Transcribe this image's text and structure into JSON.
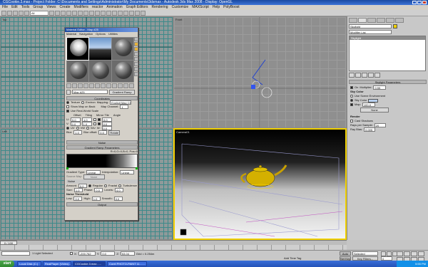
{
  "window": {
    "title": "CGCookie.3.max - Project Folder: C:\\Documents and Settings\\Administrator\\My Documents\\3dsmax - Autodesk 3ds Max 2008 - Display: OpenGL"
  },
  "menubar": [
    "File",
    "Edit",
    "Tools",
    "Group",
    "Views",
    "Create",
    "Modifiers",
    "reactor",
    "Animation",
    "Graph Editors",
    "Rendering",
    "Customize",
    "MAXScript",
    "Help",
    "PolyBoost"
  ],
  "toolbar": {
    "selection_filter": "All"
  },
  "viewports": {
    "top": {
      "label": "Top"
    },
    "front": {
      "label": "Front"
    },
    "left": {
      "label": "Left"
    },
    "perspective": {
      "label": "Camera01"
    }
  },
  "material_editor": {
    "title": "Material Editor - Map #25",
    "menu": [
      "Material",
      "Navigation",
      "Options",
      "Utilities"
    ],
    "map_name": "Map #25",
    "map_type": "Gradient Ramp",
    "coordinates": {
      "header": "Coordinates",
      "texture": "Texture",
      "environ": "Environ",
      "mapping_label": "Mapping:",
      "mapping": "Explicit Map Channel",
      "show_map_on_back": "Show Map on Back",
      "map_channel_label": "Map Channel:",
      "map_channel": "1",
      "use_real_world": "Use Real-World Scale",
      "offset": "Offset",
      "tiling": "Tiling",
      "mirror_tile": "Mirror Tile",
      "angle": "Angle",
      "u": "U:",
      "v": "V:",
      "w": "W:",
      "u_offset": "0.0",
      "v_offset": "0.0",
      "u_tiling": "1.0",
      "v_tiling": "1.0",
      "u_angle": "0.0",
      "v_angle": "0.0",
      "w_angle": "0.0",
      "uv": "UV",
      "vw": "VW",
      "wu": "WU",
      "blur_label": "Blur:",
      "blur": "1.0",
      "blur_offset_label": "Blur offset:",
      "blur_offset": "0.0",
      "rotate": "Rotate"
    },
    "noise_header": "Noise",
    "gradient": {
      "header": "Gradient Ramp Parameters",
      "pos_readout": "R=0,G=0,B=0, Pos=0",
      "type_label": "Gradient Type:",
      "type": "Linear",
      "interp_label": "Interpolation:",
      "interp": "Linear",
      "source_map": "Source Map",
      "none": "None"
    },
    "noise": {
      "header": "Noise",
      "amount_label": "Amount:",
      "amount": "0.0",
      "regular": "Regular",
      "fractal": "Fractal",
      "turbulence": "Turbulence",
      "size_label": "Size:",
      "size": "1.0",
      "phase_label": "Phase:",
      "phase": "0.0",
      "levels_label": "Levels:",
      "levels": "4.0"
    },
    "thresholds": {
      "header": "Noise Threshold",
      "low_label": "Low:",
      "low": "0.0",
      "high_label": "High:",
      "high": "1.0",
      "smooth_label": "Smooth:",
      "smooth": "0.0"
    },
    "output_header": "Output"
  },
  "command_panel": {
    "object_name": "Skylight",
    "modifier_list": "Modifier List",
    "stack_item": "Skylight",
    "rollout": "Skylight Parameters",
    "on_label": "On",
    "multiplier_label": "Multiplier:",
    "multiplier": "0.55",
    "sky_color_label": "Sky Color",
    "use_scene_env": "Use Scene Environment",
    "sky_color": "Sky Color",
    "map_label": "Map:",
    "map_value": "100.0",
    "none_btn": "None",
    "render_label": "Render",
    "cast_shadows": "Cast Shadows",
    "rays_label": "Rays per Sample:",
    "rays": "20",
    "ray_bias_label": "Ray Bias:",
    "ray_bias": "0.005",
    "accent": "#f0d000"
  },
  "timeline": {
    "frame": "0 / 100"
  },
  "status": {
    "selection": "1 Light Selected",
    "x_label": "X:",
    "x": "-200.762",
    "y_label": "Y:",
    "y": "0.0",
    "z_label": "Z:",
    "z": "53.04",
    "grid": "Grid = 0.254m",
    "auto_key": "Auto Key",
    "selected": "Selected",
    "set_key": "Set Key",
    "key_filters": "Key Filters...",
    "add_time_tag": "Add Time Tag",
    "frame": "0"
  },
  "taskbar": {
    "start": "start",
    "tasks": [
      "Local Disk (C:)",
      "RealPlayer (Video)...",
      "CGCookie.3.max - ...",
      "Corel PHOTO-PAINT 11 - ..."
    ],
    "clock": "5:55 PM"
  }
}
